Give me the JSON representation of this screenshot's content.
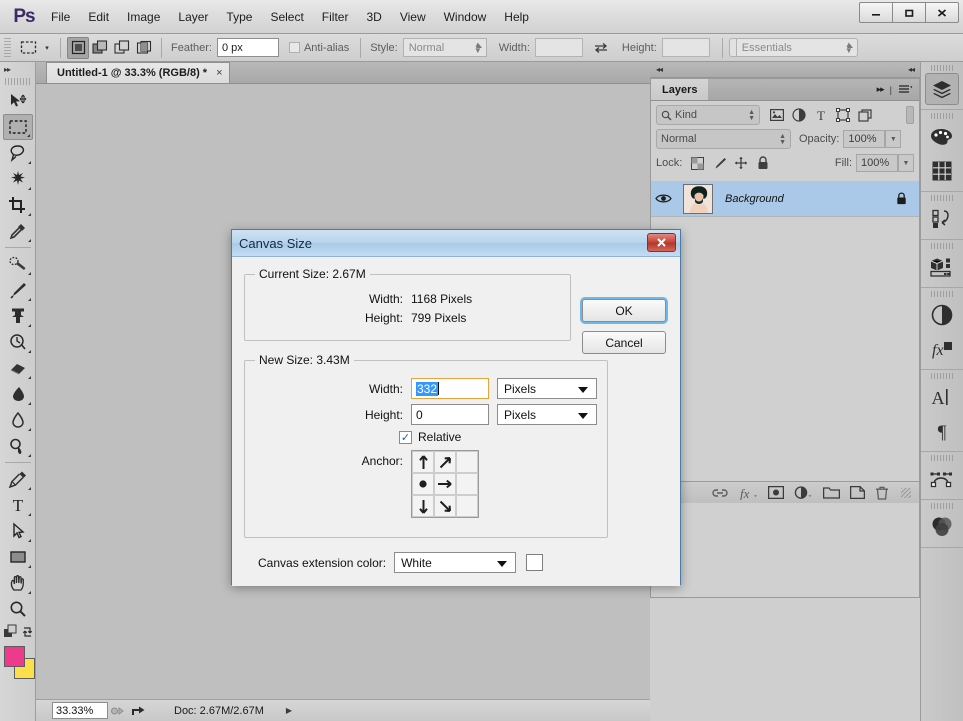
{
  "app": {
    "logo": "Ps",
    "menus": [
      "File",
      "Edit",
      "Image",
      "Layer",
      "Type",
      "Select",
      "Filter",
      "3D",
      "View",
      "Window",
      "Help"
    ],
    "window_controls": {
      "minimize": "–",
      "maximize": "❑",
      "close": "✕"
    }
  },
  "options_bar": {
    "tool_preset_caret": "▾",
    "selection_modes": [
      "new-selection",
      "add-to-selection",
      "subtract-from-selection",
      "intersect-with-selection"
    ],
    "feather_label": "Feather:",
    "feather_value": "0 px",
    "antialias_label": "Anti-alias",
    "style_label": "Style:",
    "style_value": "Normal",
    "width_label": "Width:",
    "width_value": "",
    "swap_icon": "⇄",
    "height_label": "Height:",
    "height_value": "",
    "workspace_value": "Essentials"
  },
  "toolbar": {
    "collapse_icon": "▸▸",
    "tools": [
      {
        "name": "move-tool",
        "selected": false
      },
      {
        "name": "rectangular-marquee-tool",
        "selected": true
      },
      {
        "name": "lasso-tool",
        "selected": false
      },
      {
        "name": "magic-wand-tool",
        "selected": false
      },
      {
        "name": "crop-tool",
        "selected": false
      },
      {
        "name": "eyedropper-tool",
        "selected": false
      },
      {
        "name": "spot-healing-brush-tool",
        "selected": false
      },
      {
        "name": "brush-tool",
        "selected": false
      },
      {
        "name": "clone-stamp-tool",
        "selected": false
      },
      {
        "name": "history-brush-tool",
        "selected": false
      },
      {
        "name": "eraser-tool",
        "selected": false
      },
      {
        "name": "gradient-tool",
        "selected": false
      },
      {
        "name": "blur-tool",
        "selected": false
      },
      {
        "name": "dodge-tool",
        "selected": false
      },
      {
        "name": "pen-tool",
        "selected": false
      },
      {
        "name": "horizontal-type-tool",
        "selected": false
      },
      {
        "name": "path-selection-tool",
        "selected": false
      },
      {
        "name": "rectangle-tool",
        "selected": false
      },
      {
        "name": "hand-tool",
        "selected": false
      },
      {
        "name": "zoom-tool",
        "selected": false
      }
    ],
    "foreground_color": "#ee3a8c",
    "background_color": "#fbe04b"
  },
  "document": {
    "tab_title": "Untitled-1 @ 33.3% (RGB/8) *",
    "tab_close": "×"
  },
  "status_bar": {
    "zoom": "33.33%",
    "doc_info": "Doc: 2.67M/2.67M",
    "arrow": "▶"
  },
  "layers_panel": {
    "tabs": [
      {
        "label": "Layers",
        "active": true
      }
    ],
    "collapse_icon": "▸▸",
    "menu_icon": "≡",
    "filter_label": "Kind",
    "filter_icons": [
      "pixel-layer-filter-icon",
      "adjustment-layer-filter-icon",
      "type-layer-filter-icon",
      "shape-layer-filter-icon",
      "smart-object-filter-icon"
    ],
    "blend_mode": "Normal",
    "opacity_label": "Opacity:",
    "opacity_value": "100%",
    "lock_label": "Lock:",
    "lock_icons": [
      "lock-transparent-pixels-icon",
      "lock-image-pixels-icon",
      "lock-position-icon",
      "lock-all-icon"
    ],
    "fill_label": "Fill:",
    "fill_value": "100%",
    "layers": [
      {
        "name": "Background",
        "visible": true,
        "locked": true,
        "selected": true
      }
    ],
    "footer_icons": [
      "link-layers-icon",
      "layer-style-fx-icon",
      "layer-mask-icon",
      "new-adjustment-layer-icon",
      "new-group-icon",
      "new-layer-icon",
      "delete-layer-icon"
    ]
  },
  "right_rail": {
    "groups": [
      [
        "layers-panel-icon"
      ],
      [
        "color-panel-icon",
        "swatches-panel-icon"
      ],
      [
        "history-panel-icon"
      ],
      [
        "3d-panel-icon"
      ],
      [
        "adjustments-panel-icon",
        "styles-panel-icon"
      ],
      [
        "character-panel-icon",
        "paragraph-panel-icon"
      ],
      [
        "paths-panel-icon"
      ],
      [
        "channels-panel-icon"
      ]
    ]
  },
  "dialog": {
    "title": "Canvas Size",
    "close_label": "✕",
    "current_size": {
      "legend": "Current Size: 2.67M",
      "width_label": "Width:",
      "width_value": "1168 Pixels",
      "height_label": "Height:",
      "height_value": "799 Pixels"
    },
    "new_size": {
      "legend": "New Size: 3.43M",
      "width_label": "Width:",
      "width_value": "332",
      "width_unit": "Pixels",
      "height_label": "Height:",
      "height_value": "0",
      "height_unit": "Pixels",
      "relative_label": "Relative",
      "relative_checked": true,
      "relative_check_glyph": "✓",
      "anchor_label": "Anchor:",
      "anchor_position": "middle-left"
    },
    "extension": {
      "label": "Canvas extension color:",
      "value": "White",
      "swatch_color": "#ffffff"
    },
    "buttons": {
      "ok": "OK",
      "cancel": "Cancel"
    }
  }
}
